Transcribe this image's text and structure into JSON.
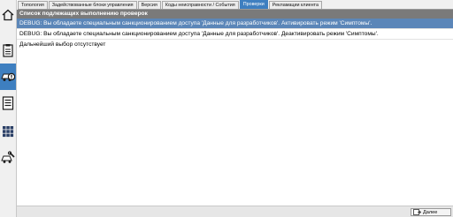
{
  "tabs": [
    {
      "label": "Топология",
      "active": false
    },
    {
      "label": "Задействованные блоки управления",
      "active": false
    },
    {
      "label": "Версия",
      "active": false
    },
    {
      "label": "Коды неисправности / События",
      "active": false
    },
    {
      "label": "Проверки",
      "active": true
    },
    {
      "label": "Рекламации клиента",
      "active": false
    }
  ],
  "sidebar": {
    "items": [
      {
        "icon": "home-icon"
      },
      {
        "icon": "clipboard-icon"
      },
      {
        "icon": "car-diagnostic-icon",
        "active": true
      },
      {
        "icon": "list-icon"
      },
      {
        "icon": "grid-icon"
      },
      {
        "icon": "car-tools-icon"
      }
    ]
  },
  "panel": {
    "header": "Список подлежащих выполнению проверок",
    "rows": [
      "DEBUG:  Вы обладаете специальным санкционированием доступа 'Данные для разработчиков'. Активировать режим 'Симптомы'.",
      "DEBUG:  Вы обладаете специальным санкционированием доступа 'Данные для разработчиков'. Деактивировать режим 'Симптомы'.",
      "Дальнейший выбор отсутствует"
    ]
  },
  "footer": {
    "next_label": "Далее"
  },
  "colors": {
    "accent": "#3e7fc0",
    "header_bg": "#7a7a7a",
    "selected_row": "#5b86b8"
  }
}
